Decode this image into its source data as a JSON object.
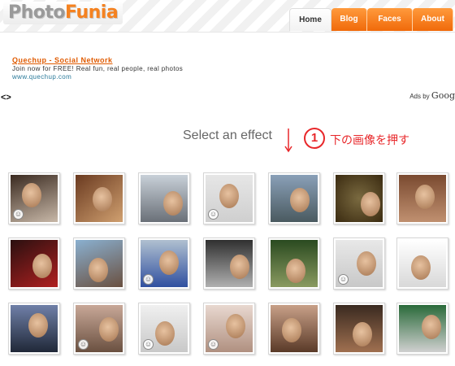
{
  "logo": {
    "part1": "Photo",
    "part2": "Funia"
  },
  "nav": {
    "tabs": [
      {
        "label": "Home",
        "active": true
      },
      {
        "label": "Blog",
        "active": false
      },
      {
        "label": "Faces",
        "active": false
      },
      {
        "label": "About",
        "active": false
      }
    ]
  },
  "ad": {
    "title": "Quechup - Social Network",
    "description": "Join now for FREE! Real fun, real people, real photos",
    "url": "www.quechup.com",
    "arrows": "<>",
    "ads_by": "Ads by",
    "google": "Goog"
  },
  "instruction": {
    "select_effect": "Select an effect",
    "step_number": "1",
    "step_text": "下の画像を押す"
  },
  "colors": {
    "accent_orange": "#f58220",
    "tab_orange": "#f06a0a",
    "annotation_red": "#e8272a"
  }
}
